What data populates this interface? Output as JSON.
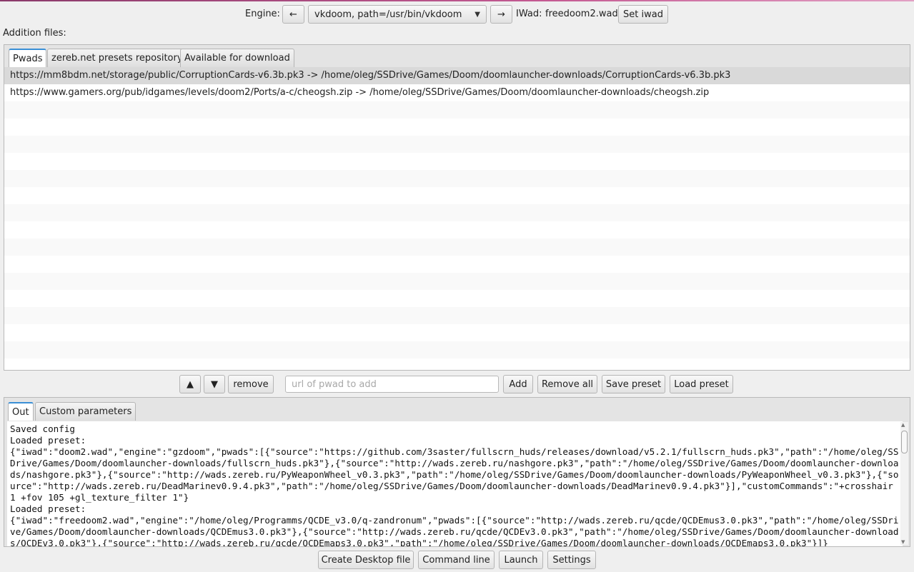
{
  "engine": {
    "label": "Engine:",
    "prev_label": "←",
    "next_label": "→",
    "selected": "vkdoom, path=/usr/bin/vkdoom",
    "iwad_label": "IWad:",
    "iwad_value": "freedoom2.wad",
    "set_iwad_label": "Set iwad"
  },
  "additions_label": "Addition files:",
  "top_tabs": [
    {
      "label": "Pwads",
      "active": true
    },
    {
      "label": "zereb.net presets repository",
      "active": false
    },
    {
      "label": "Available for download",
      "active": false
    }
  ],
  "pwads": [
    "https://mm8bdm.net/storage/public/CorruptionCards-v6.3b.pk3 -> /home/oleg/SSDrive/Games/Doom/doomlauncher-downloads/CorruptionCards-v6.3b.pk3",
    "https://www.gamers.org/pub/idgames/levels/doom2/Ports/a-c/cheogsh.zip -> /home/oleg/SSDrive/Games/Doom/doomlauncher-downloads/cheogsh.zip"
  ],
  "list_toolbar": {
    "move_up_label": "▲",
    "move_down_label": "▼",
    "remove_label": "remove",
    "url_placeholder": "url of pwad to add",
    "add_label": "Add",
    "remove_all_label": "Remove all",
    "save_preset_label": "Save preset",
    "load_preset_label": "Load preset"
  },
  "bottom_tabs": [
    {
      "label": "Out",
      "active": true
    },
    {
      "label": "Custom parameters",
      "active": false
    }
  ],
  "output_text": "Saved config\nLoaded preset:\n{\"iwad\":\"doom2.wad\",\"engine\":\"gzdoom\",\"pwads\":[{\"source\":\"https://github.com/3saster/fullscrn_huds/releases/download/v5.2.1/fullscrn_huds.pk3\",\"path\":\"/home/oleg/SSDrive/Games/Doom/doomlauncher-downloads/fullscrn_huds.pk3\"},{\"source\":\"http://wads.zereb.ru/nashgore.pk3\",\"path\":\"/home/oleg/SSDrive/Games/Doom/doomlauncher-downloads/nashgore.pk3\"},{\"source\":\"http://wads.zereb.ru/PyWeaponWheel_v0.3.pk3\",\"path\":\"/home/oleg/SSDrive/Games/Doom/doomlauncher-downloads/PyWeaponWheel_v0.3.pk3\"},{\"source\":\"http://wads.zereb.ru/DeadMarinev0.9.4.pk3\",\"path\":\"/home/oleg/SSDrive/Games/Doom/doomlauncher-downloads/DeadMarinev0.9.4.pk3\"}],\"customCommands\":\"+crosshair 1 +fov 105 +gl_texture_filter 1\"}\nLoaded preset:\n{\"iwad\":\"freedoom2.wad\",\"engine\":\"/home/oleg/Programms/QCDE_v3.0/q-zandronum\",\"pwads\":[{\"source\":\"http://wads.zereb.ru/qcde/QCDEmus3.0.pk3\",\"path\":\"/home/oleg/SSDrive/Games/Doom/doomlauncher-downloads/QCDEmus3.0.pk3\"},{\"source\":\"http://wads.zereb.ru/qcde/QCDEv3.0.pk3\",\"path\":\"/home/oleg/SSDrive/Games/Doom/doomlauncher-downloads/QCDEv3.0.pk3\"},{\"source\":\"http://wads.zereb.ru/qcde/QCDEmaps3.0.pk3\",\"path\":\"/home/oleg/SSDrive/Games/Doom/doomlauncher-downloads/QCDEmaps3.0.pk3\"}]}",
  "bottom_bar": {
    "create_desktop_label": "Create Desktop file",
    "command_line_label": "Command line",
    "launch_label": "Launch",
    "settings_label": "Settings"
  }
}
